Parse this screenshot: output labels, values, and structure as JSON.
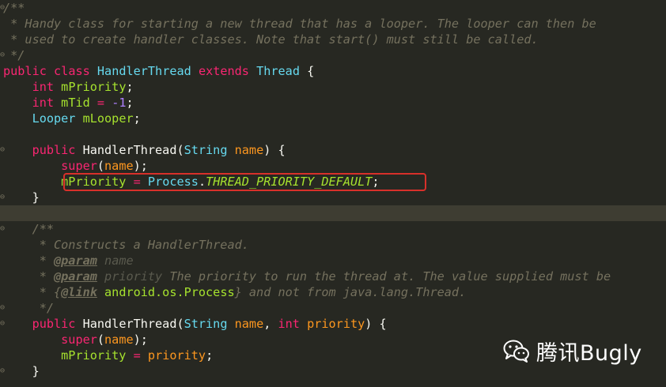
{
  "editor": {
    "lines": [
      {
        "fold": "⊖",
        "tokens": [
          {
            "c": "cm",
            "t": "/**"
          }
        ]
      },
      {
        "tokens": [
          {
            "c": "cm",
            "t": " * Handy class for starting a new thread that has a looper. The looper can then be"
          }
        ]
      },
      {
        "tokens": [
          {
            "c": "cm",
            "t": " * used to create handler classes. Note that start() must still be called."
          }
        ]
      },
      {
        "fold": "⊖",
        "tokens": [
          {
            "c": "cm",
            "t": " */"
          }
        ]
      },
      {
        "tokens": [
          {
            "c": "kw",
            "t": "public"
          },
          {
            "c": "plain",
            "t": " "
          },
          {
            "c": "kw",
            "t": "class"
          },
          {
            "c": "plain",
            "t": " "
          },
          {
            "c": "cls",
            "t": "HandlerThread"
          },
          {
            "c": "plain",
            "t": " "
          },
          {
            "c": "kw",
            "t": "extends"
          },
          {
            "c": "plain",
            "t": " "
          },
          {
            "c": "cls",
            "t": "Thread"
          },
          {
            "c": "plain",
            "t": " {"
          }
        ]
      },
      {
        "tokens": [
          {
            "c": "plain",
            "t": "    "
          },
          {
            "c": "kw",
            "t": "int"
          },
          {
            "c": "plain",
            "t": " "
          },
          {
            "c": "fld",
            "t": "mPriority"
          },
          {
            "c": "plain",
            "t": ";"
          }
        ]
      },
      {
        "tokens": [
          {
            "c": "plain",
            "t": "    "
          },
          {
            "c": "kw",
            "t": "int"
          },
          {
            "c": "plain",
            "t": " "
          },
          {
            "c": "fld",
            "t": "mTid"
          },
          {
            "c": "plain",
            "t": " "
          },
          {
            "c": "kw",
            "t": "="
          },
          {
            "c": "plain",
            "t": " "
          },
          {
            "c": "num",
            "t": "-1"
          },
          {
            "c": "plain",
            "t": ";"
          }
        ]
      },
      {
        "tokens": [
          {
            "c": "plain",
            "t": "    "
          },
          {
            "c": "ty",
            "t": "Looper"
          },
          {
            "c": "plain",
            "t": " "
          },
          {
            "c": "fld",
            "t": "mLooper"
          },
          {
            "c": "plain",
            "t": ";"
          }
        ]
      },
      {
        "tokens": []
      },
      {
        "fold": "⊖",
        "tokens": [
          {
            "c": "plain",
            "t": "    "
          },
          {
            "c": "kw",
            "t": "public"
          },
          {
            "c": "plain",
            "t": " HandlerThread("
          },
          {
            "c": "ty",
            "t": "String"
          },
          {
            "c": "plain",
            "t": " "
          },
          {
            "c": "par",
            "t": "name"
          },
          {
            "c": "plain",
            "t": ") {"
          }
        ]
      },
      {
        "tokens": [
          {
            "c": "plain",
            "t": "        "
          },
          {
            "c": "kw",
            "t": "super"
          },
          {
            "c": "plain",
            "t": "("
          },
          {
            "c": "par",
            "t": "name"
          },
          {
            "c": "plain",
            "t": ");"
          }
        ]
      },
      {
        "tokens": [
          {
            "c": "plain",
            "t": "        "
          },
          {
            "c": "fld",
            "t": "mPriority"
          },
          {
            "c": "plain",
            "t": " "
          },
          {
            "c": "kw",
            "t": "="
          },
          {
            "c": "plain",
            "t": " "
          },
          {
            "c": "cls",
            "t": "Process"
          },
          {
            "c": "plain",
            "t": "."
          },
          {
            "c": "const",
            "t": "THREAD_PRIORITY_DEFAULT"
          },
          {
            "c": "plain",
            "t": ";"
          }
        ]
      },
      {
        "fold": "⊖",
        "tokens": [
          {
            "c": "plain",
            "t": "    }"
          }
        ]
      },
      {
        "current": true,
        "tokens": []
      },
      {
        "fold": "⊖",
        "tokens": [
          {
            "c": "plain",
            "t": "    "
          },
          {
            "c": "cm",
            "t": "/**"
          }
        ]
      },
      {
        "tokens": [
          {
            "c": "cm",
            "t": "     * Constructs a HandlerThread."
          }
        ]
      },
      {
        "tokens": [
          {
            "c": "cm",
            "t": "     * "
          },
          {
            "c": "tag",
            "t": "@param"
          },
          {
            "c": "cm",
            "t": " "
          },
          {
            "c": "dimparam",
            "t": "name"
          }
        ]
      },
      {
        "tokens": [
          {
            "c": "cm",
            "t": "     * "
          },
          {
            "c": "tag",
            "t": "@param"
          },
          {
            "c": "cm",
            "t": " "
          },
          {
            "c": "dimparam",
            "t": "priority"
          },
          {
            "c": "cm",
            "t": " The priority to run the thread at. The value supplied must be"
          }
        ]
      },
      {
        "tokens": [
          {
            "c": "cm",
            "t": "     * {"
          },
          {
            "c": "tag",
            "t": "@link"
          },
          {
            "c": "cm",
            "t": " "
          },
          {
            "c": "linkref",
            "t": "android.os.Process"
          },
          {
            "c": "cm",
            "t": "} and not from java.lang.Thread."
          }
        ]
      },
      {
        "fold": "⊖",
        "tokens": [
          {
            "c": "cm",
            "t": "     */"
          }
        ]
      },
      {
        "fold": "⊖",
        "tokens": [
          {
            "c": "plain",
            "t": "    "
          },
          {
            "c": "kw",
            "t": "public"
          },
          {
            "c": "plain",
            "t": " HandlerThread("
          },
          {
            "c": "ty",
            "t": "String"
          },
          {
            "c": "plain",
            "t": " "
          },
          {
            "c": "par",
            "t": "name"
          },
          {
            "c": "plain",
            "t": ", "
          },
          {
            "c": "kw",
            "t": "int"
          },
          {
            "c": "plain",
            "t": " "
          },
          {
            "c": "par",
            "t": "priority"
          },
          {
            "c": "plain",
            "t": ") {"
          }
        ]
      },
      {
        "tokens": [
          {
            "c": "plain",
            "t": "        "
          },
          {
            "c": "kw",
            "t": "super"
          },
          {
            "c": "plain",
            "t": "("
          },
          {
            "c": "par",
            "t": "name"
          },
          {
            "c": "plain",
            "t": ");"
          }
        ]
      },
      {
        "tokens": [
          {
            "c": "plain",
            "t": "        "
          },
          {
            "c": "fld",
            "t": "mPriority"
          },
          {
            "c": "plain",
            "t": " "
          },
          {
            "c": "kw",
            "t": "="
          },
          {
            "c": "plain",
            "t": " "
          },
          {
            "c": "par",
            "t": "priority"
          },
          {
            "c": "plain",
            "t": ";"
          }
        ]
      },
      {
        "fold": "⊖",
        "tokens": [
          {
            "c": "plain",
            "t": "    }"
          }
        ]
      }
    ]
  },
  "watermark": {
    "icon": "wechat-icon",
    "text": "腾讯Bugly"
  },
  "colors": {
    "background": "#272822",
    "highlight_border": "#d8302a"
  }
}
